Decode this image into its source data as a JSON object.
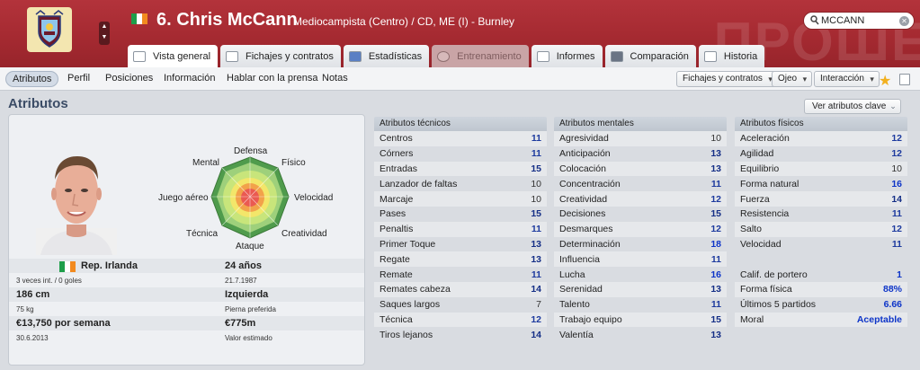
{
  "header": {
    "player_name": "6. Chris McCann",
    "player_desc": "Mediocampista (Centro) / CD, ME (I) - Burnley",
    "watermark": "ПРОШЕ",
    "search_value": "MCCANN"
  },
  "tabs": [
    {
      "label": "Vista general",
      "active": true
    },
    {
      "label": "Fichajes y contratos"
    },
    {
      "label": "Estadísticas"
    },
    {
      "label": "Entrenamiento",
      "disabled": true
    },
    {
      "label": "Informes"
    },
    {
      "label": "Comparación"
    },
    {
      "label": "Historia"
    }
  ],
  "subnav": {
    "items": [
      "Atributos",
      "Perfil",
      "Posiciones",
      "Información",
      "Hablar con la prensa",
      "Notas"
    ],
    "dropdowns": [
      "Fichajes y contratos",
      "Ojeo",
      "Interacción"
    ]
  },
  "page": {
    "title": "Atributos",
    "key_button": "Ver atributos clave"
  },
  "radar": {
    "labels": [
      "Defensa",
      "Físico",
      "Velocidad",
      "Creatividad",
      "Ataque",
      "Técnica",
      "Juego aéreo",
      "Mental"
    ]
  },
  "profile": {
    "nationality": "Rep. Irlanda",
    "caps": "3 veces int. / 0 goles",
    "age": "24 años",
    "dob": "21.7.1987",
    "height": "186 cm",
    "weight": "75 kg",
    "foot": "Izquierda",
    "foot_label": "Pierna preferida",
    "wage": "€13,750 por semana",
    "contract": "30.6.2013",
    "value": "€775m",
    "value_label": "Valor estimado"
  },
  "technical": {
    "title": "Atributos técnicos",
    "rows": [
      {
        "name": "Centros",
        "value": "11"
      },
      {
        "name": "Córners",
        "value": "11"
      },
      {
        "name": "Entradas",
        "value": "15"
      },
      {
        "name": "Lanzador de faltas",
        "value": "10"
      },
      {
        "name": "Marcaje",
        "value": "10"
      },
      {
        "name": "Pases",
        "value": "15"
      },
      {
        "name": "Penaltis",
        "value": "11"
      },
      {
        "name": "Primer Toque",
        "value": "13"
      },
      {
        "name": "Regate",
        "value": "13"
      },
      {
        "name": "Remate",
        "value": "11"
      },
      {
        "name": "Remates cabeza",
        "value": "14"
      },
      {
        "name": "Saques largos",
        "value": "7"
      },
      {
        "name": "Técnica",
        "value": "12"
      },
      {
        "name": "Tiros lejanos",
        "value": "14"
      }
    ]
  },
  "mental": {
    "title": "Atributos mentales",
    "rows": [
      {
        "name": "Agresividad",
        "value": "10"
      },
      {
        "name": "Anticipación",
        "value": "13"
      },
      {
        "name": "Colocación",
        "value": "13"
      },
      {
        "name": "Concentración",
        "value": "11"
      },
      {
        "name": "Creatividad",
        "value": "12"
      },
      {
        "name": "Decisiones",
        "value": "15"
      },
      {
        "name": "Desmarques",
        "value": "12"
      },
      {
        "name": "Determinación",
        "value": "18"
      },
      {
        "name": "Influencia",
        "value": "11"
      },
      {
        "name": "Lucha",
        "value": "16"
      },
      {
        "name": "Serenidad",
        "value": "13"
      },
      {
        "name": "Talento",
        "value": "11"
      },
      {
        "name": "Trabajo equipo",
        "value": "15"
      },
      {
        "name": "Valentía",
        "value": "13"
      }
    ]
  },
  "physical": {
    "title": "Atributos físicos",
    "rows": [
      {
        "name": "Aceleración",
        "value": "12"
      },
      {
        "name": "Agilidad",
        "value": "12"
      },
      {
        "name": "Equilibrio",
        "value": "10"
      },
      {
        "name": "Forma natural",
        "value": "16"
      },
      {
        "name": "Fuerza",
        "value": "14"
      },
      {
        "name": "Resistencia",
        "value": "11"
      },
      {
        "name": "Salto",
        "value": "12"
      },
      {
        "name": "Velocidad",
        "value": "11"
      }
    ],
    "extra": [
      {
        "name": "Calif. de portero",
        "value": "1"
      },
      {
        "name": "Forma física",
        "value": "88%"
      },
      {
        "name": "Últimos 5 partidos",
        "value": "6.66"
      },
      {
        "name": "Moral",
        "value": "Aceptable"
      }
    ]
  }
}
